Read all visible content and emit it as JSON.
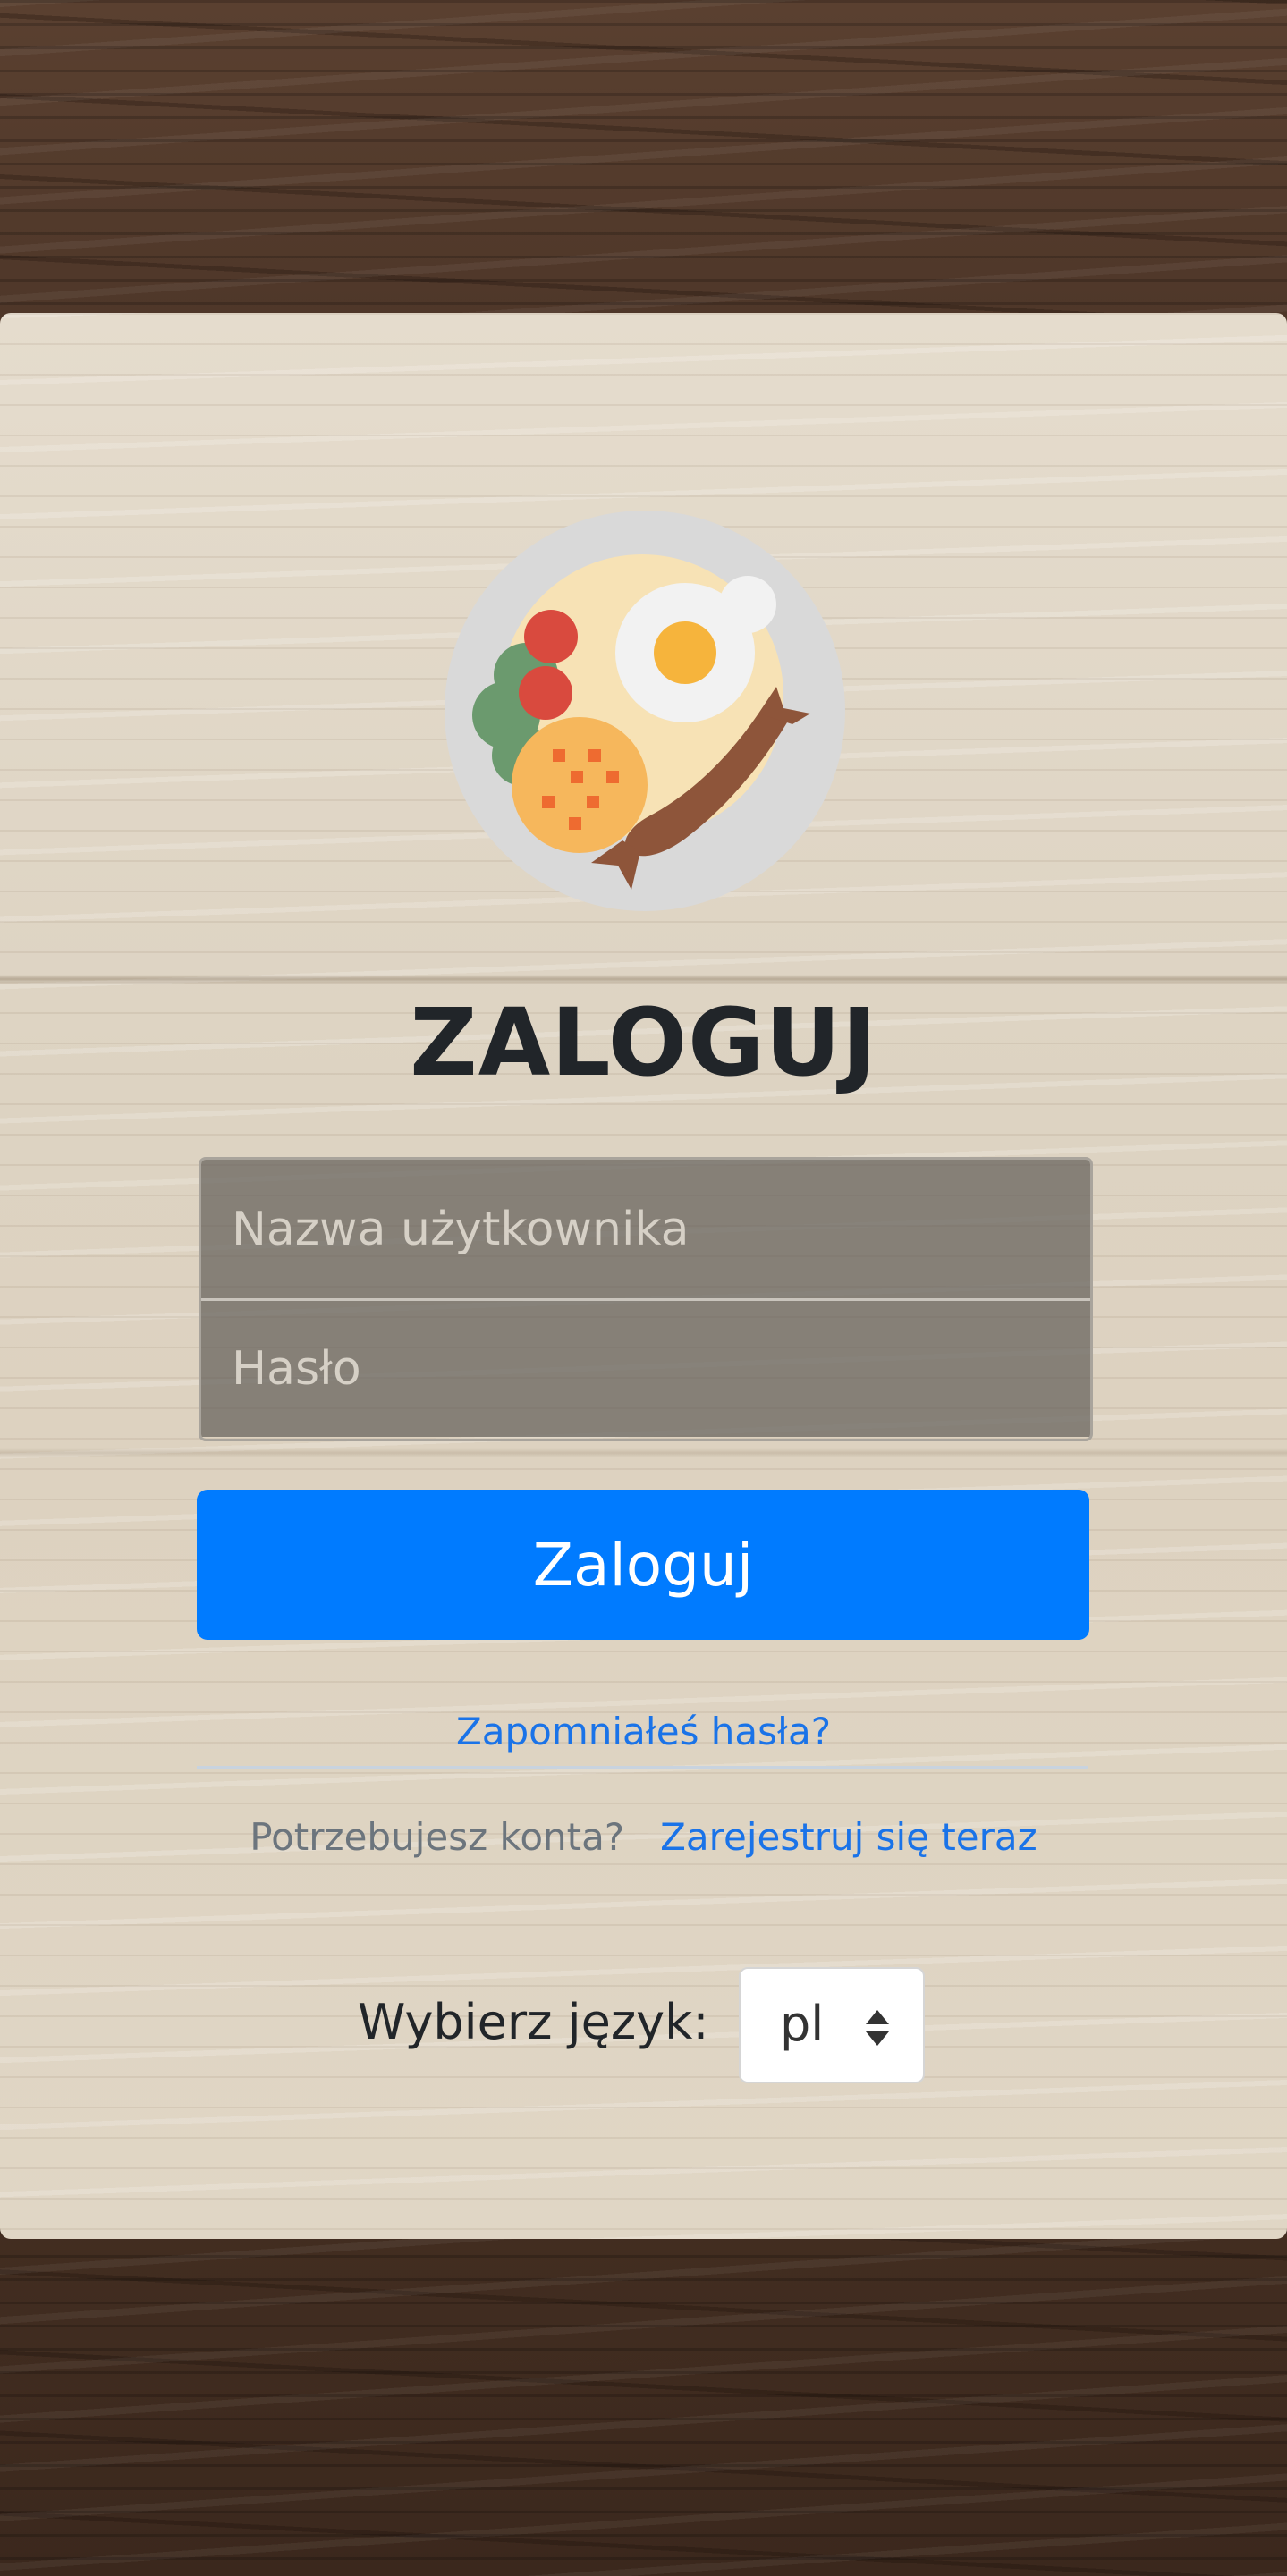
{
  "logo": {
    "icon": "plate-with-food-icon"
  },
  "login": {
    "title": "ZALOGUJ",
    "username_placeholder": "Nazwa użytkownika",
    "password_placeholder": "Hasło",
    "submit_label": "Zaloguj"
  },
  "links": {
    "forgot_password": "Zapomniałeś hasła?",
    "need_account": "Potrzebujesz konta?",
    "register_now": "Zarejestruj się teraz"
  },
  "language": {
    "label": "Wybierz język:",
    "selected": "pl"
  },
  "colors": {
    "primary_button": "#007bff",
    "link": "#1a73e8"
  }
}
